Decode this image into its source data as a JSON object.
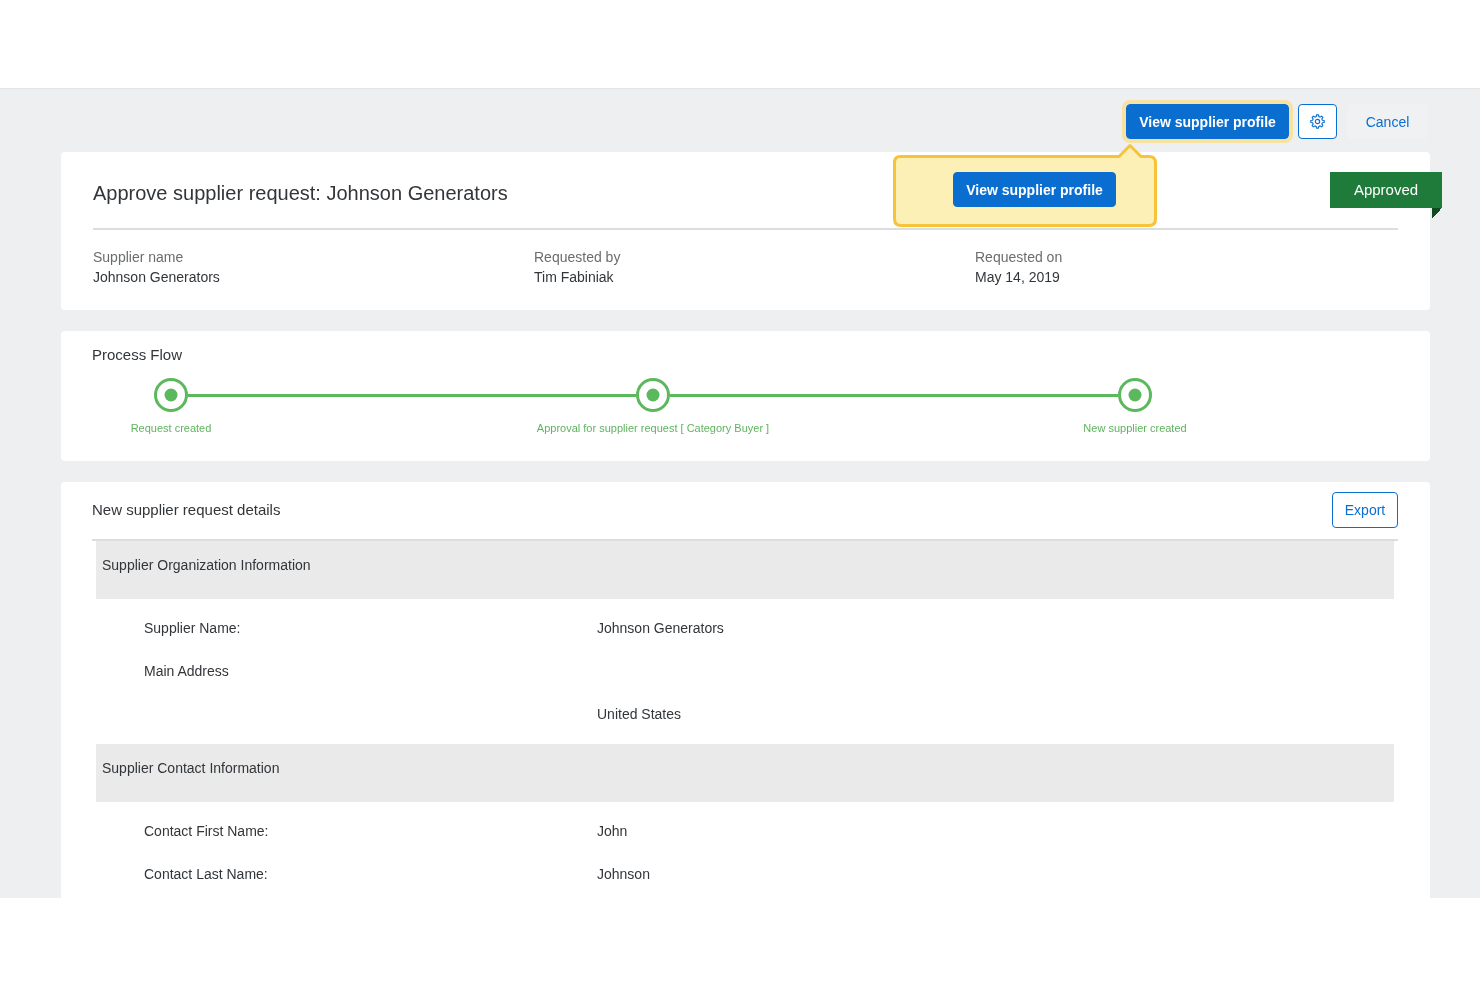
{
  "toolbar": {
    "buttons": [
      {
        "kind": "primary",
        "label": "View supplier profile",
        "highlighted": true
      },
      {
        "kind": "settings"
      },
      {
        "kind": "secondary",
        "label": "Cancel"
      }
    ]
  },
  "header": {
    "title": "Approve supplier request: Johnson Generators",
    "status": {
      "label": "Approved",
      "kind": "approved"
    },
    "fields": [
      {
        "label": "Supplier name",
        "value": "Johnson Generators"
      },
      {
        "label": "Requested by",
        "value": "Tim Fabiniak"
      },
      {
        "label": "Requested on",
        "value": "May 14, 2019"
      }
    ]
  },
  "callout": {
    "button": "View supplier profile"
  },
  "process_flow": {
    "title": "Process Flow",
    "steps": [
      {
        "label": "Request created",
        "completed": true
      },
      {
        "label": "Approval for supplier request [ Category Buyer ]",
        "completed": true
      },
      {
        "label": "New supplier created",
        "completed": true
      }
    ]
  },
  "details": {
    "title": "New supplier request details",
    "export_button": "Export",
    "sections": [
      {
        "title": "Supplier Organization Information",
        "rows": [
          {
            "label": "Supplier Name:",
            "value": "Johnson Generators"
          },
          {
            "label": "Main Address"
          },
          {
            "value": "United States"
          }
        ]
      },
      {
        "title": "Supplier Contact Information",
        "rows": [
          {
            "label": "Contact First Name:",
            "value": "John"
          },
          {
            "label": "Contact Last Name:",
            "value": "Johnson"
          }
        ]
      }
    ]
  }
}
